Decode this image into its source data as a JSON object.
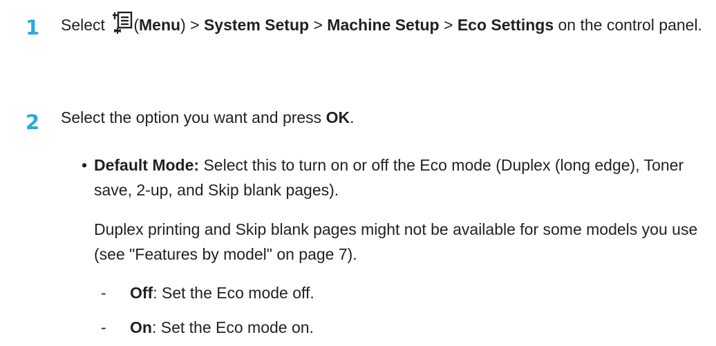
{
  "steps": [
    {
      "number": "1",
      "prefix": "Select ",
      "menu_paren_open": "(",
      "menu_label": "Menu",
      "menu_paren_close": ")",
      "sep1": " > ",
      "path1": "System Setup",
      "sep2": " > ",
      "path2": "Machine Setup",
      "sep3": " > ",
      "path3": "Eco Settings",
      "suffix": " on the control panel.",
      "icon": "menu-icon"
    },
    {
      "number": "2",
      "prefix": "Select the option you want and press ",
      "key": "OK",
      "suffix": "."
    }
  ],
  "bullet": {
    "marker": "•",
    "label": "Default Mode:",
    "text": " Select this to turn on or off the Eco mode (Duplex (long edge), Toner save, 2-up, and Skip blank pages).",
    "note": "Duplex printing and Skip blank pages might not be available for some models you use (see \"Features by model\" on page 7)."
  },
  "sub_items": [
    {
      "marker": "-",
      "label": "Off",
      "text": ": Set the Eco mode off."
    },
    {
      "marker": "-",
      "label": "On",
      "text": ": Set the Eco mode on."
    }
  ]
}
